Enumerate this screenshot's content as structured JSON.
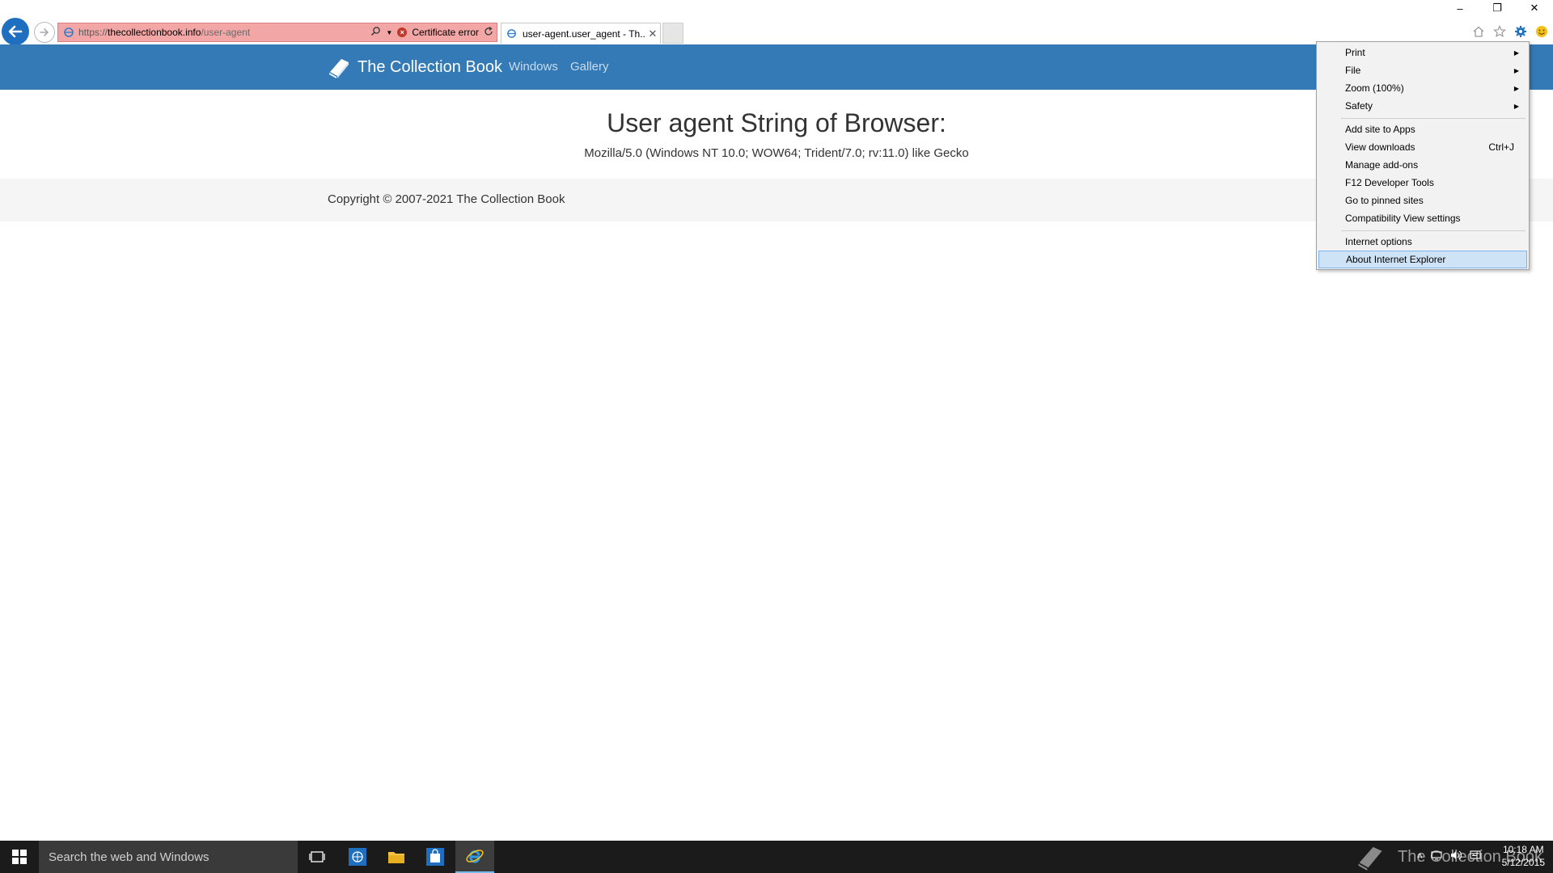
{
  "window": {
    "minimize": "–",
    "restore": "❐",
    "close": "✕"
  },
  "address_bar": {
    "url_scheme": "https://",
    "url_host": "thecollectionbook.info",
    "url_path": "/user-agent",
    "certificate_error": "Certificate error"
  },
  "tab": {
    "title": "user-agent.user_agent - Th..."
  },
  "site": {
    "brand": "The Collection Book",
    "nav": [
      "Windows",
      "Gallery"
    ]
  },
  "page": {
    "heading": "User agent String of Browser:",
    "user_agent": "Mozilla/5.0 (Windows NT 10.0; WOW64; Trident/7.0; rv:11.0) like Gecko",
    "footer": "Copyright © 2007-2021 The Collection Book"
  },
  "tools_menu": {
    "items": [
      {
        "label": "Print",
        "submenu": true
      },
      {
        "label": "File",
        "submenu": true
      },
      {
        "label": "Zoom (100%)",
        "submenu": true
      },
      {
        "label": "Safety",
        "submenu": true
      },
      {
        "label": "Add site to Apps"
      },
      {
        "label": "View downloads",
        "shortcut": "Ctrl+J"
      },
      {
        "label": "Manage add-ons"
      },
      {
        "label": "F12 Developer Tools"
      },
      {
        "label": "Go to pinned sites"
      },
      {
        "label": "Compatibility View settings"
      },
      {
        "label": "Internet options"
      },
      {
        "label": "About Internet Explorer",
        "highlighted": true
      }
    ]
  },
  "taskbar": {
    "search_placeholder": "Search the web and Windows",
    "watermark": "The Collection Book",
    "time": "10:18 AM",
    "date": "5/12/2015"
  },
  "colors": {
    "navbar": "#337ab7",
    "cert_error_bg": "#f3a6a6",
    "menu_highlight": "#cfe3f7"
  }
}
